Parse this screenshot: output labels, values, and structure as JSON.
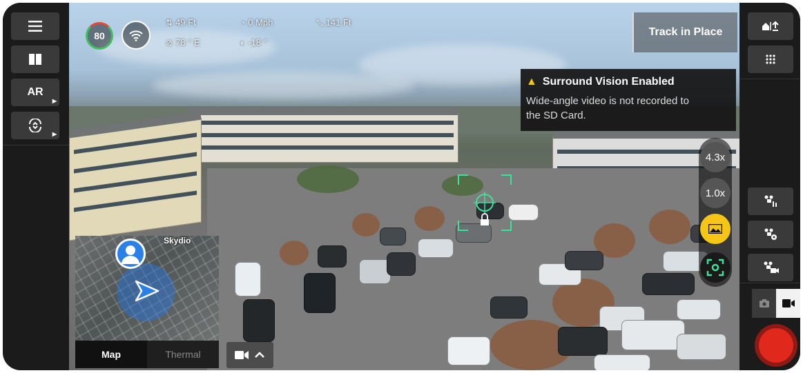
{
  "left_rail": {
    "menu_icon": "hamburger-icon",
    "layout_icon": "split-view-icon",
    "ar_label": "AR",
    "gimbal_icon": "gimbal-tilt-icon"
  },
  "telemetry": {
    "battery_percent": "80",
    "altitude": "49 Ft",
    "speed": "0 Mph",
    "distance": "141 Ft",
    "heading": "78 ° E",
    "gimbal_pitch": "-18 °"
  },
  "track_button": {
    "label": "Track in Place"
  },
  "toast": {
    "title": "Surround Vision Enabled",
    "body_line1": "Wide-angle video is not recorded to",
    "body_line2": "the SD Card."
  },
  "zoom": {
    "level_a": "4.3x",
    "level_b": "1.0x",
    "active_icon": "landscape-image-icon",
    "active_color": "#f5c518",
    "focus_icon": "focus-target-icon",
    "focus_color": "#3fe09a"
  },
  "minimap": {
    "watermark": "Skydio",
    "tabs": [
      "Map",
      "Thermal"
    ],
    "selected_tab": "Map"
  },
  "right_rail": {
    "home_icon": "home-upload-icon",
    "grid_icon": "grid-dots-icon",
    "action_icons": [
      "drone-scan-icon",
      "drone-settings-icon",
      "camera-drone-icon"
    ],
    "capture_modes": [
      "photo-icon",
      "video-icon"
    ],
    "selected_mode": "video-icon",
    "record_color": "#e0281c"
  }
}
